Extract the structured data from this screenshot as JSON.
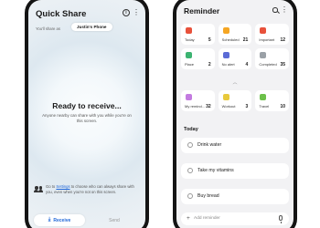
{
  "quick_share": {
    "title": "Quick Share",
    "info_icon": "info-icon",
    "more_icon": "more-vertical-icon",
    "share_as_label": "You'll share as",
    "device_name": "Justin's Phone",
    "ready_title": "Ready to receive...",
    "ready_description": "Anyone nearby can share with you while you're on this screen.",
    "settings_text_before": "Go to ",
    "settings_link": "Settings",
    "settings_text_after": " to choose who can always share with you, even when you're not on this screen.",
    "tabs": [
      {
        "label": "Receive",
        "icon": "download-icon",
        "active": true
      },
      {
        "label": "Send",
        "active": false
      }
    ]
  },
  "reminder": {
    "title": "Reminder",
    "search_icon": "search-icon",
    "more_icon": "more-vertical-icon",
    "categories": [
      {
        "label": "Today",
        "count": "5",
        "color": "#e8513b",
        "icon": "calendar-today-icon"
      },
      {
        "label": "Scheduled",
        "count": "21",
        "color": "#f5a623",
        "icon": "scheduled-icon"
      },
      {
        "label": "Important",
        "count": "12",
        "color": "#e8513b",
        "icon": "star-icon"
      },
      {
        "label": "Place",
        "count": "2",
        "color": "#3cb371",
        "icon": "place-icon"
      },
      {
        "label": "No alert",
        "count": "4",
        "color": "#5b6bd6",
        "icon": "no-alert-icon"
      },
      {
        "label": "Completed",
        "count": "35",
        "color": "#9aa0a6",
        "icon": "check-icon"
      },
      {
        "label": "My remind...",
        "count": "32",
        "color": "#c37be0",
        "icon": "bell-icon"
      },
      {
        "label": "Workout",
        "count": "3",
        "color": "#e8c93b",
        "icon": "workout-icon"
      },
      {
        "label": "Travel",
        "count": "10",
        "color": "#6cc04a",
        "icon": "travel-icon"
      }
    ],
    "collapse_icon": "chevron-up-icon",
    "section_title": "Today",
    "items": [
      {
        "text": "Drink water"
      },
      {
        "text": "Take my vitamins"
      },
      {
        "text": "Buy bread"
      }
    ],
    "add_placeholder": "Add reminder",
    "add_icon": "plus-icon",
    "mic_icon": "mic-icon"
  }
}
